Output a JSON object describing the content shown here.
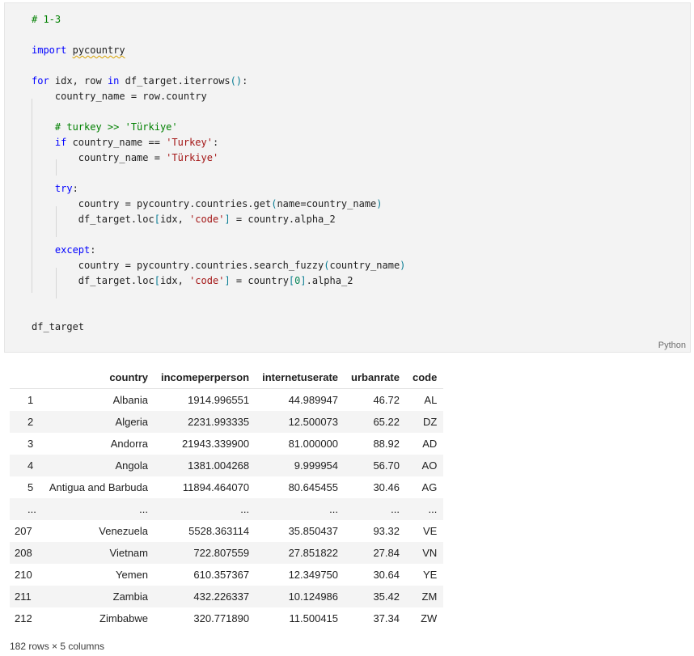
{
  "cell": {
    "language": "Python",
    "lines": [
      {
        "indent": 0,
        "tokens": [
          {
            "c": "cm",
            "t": "# 1-3"
          }
        ]
      },
      {
        "indent": 0,
        "tokens": []
      },
      {
        "indent": 0,
        "tokens": [
          {
            "c": "kw",
            "t": "import"
          },
          {
            "c": "",
            "t": " "
          },
          {
            "c": "squiggle",
            "t": "pycountry"
          }
        ]
      },
      {
        "indent": 0,
        "tokens": []
      },
      {
        "indent": 0,
        "tokens": [
          {
            "c": "kw",
            "t": "for"
          },
          {
            "c": "",
            "t": " idx, row "
          },
          {
            "c": "kw",
            "t": "in"
          },
          {
            "c": "",
            "t": " df_target.iterrows"
          },
          {
            "c": "paren",
            "t": "()"
          },
          {
            "c": "",
            "t": ":"
          }
        ]
      },
      {
        "indent": 1,
        "tokens": [
          {
            "c": "",
            "t": "country_name = row.country"
          }
        ]
      },
      {
        "indent": 1,
        "tokens": []
      },
      {
        "indent": 1,
        "tokens": [
          {
            "c": "cm",
            "t": "# turkey >> 'Türkiye'"
          }
        ]
      },
      {
        "indent": 1,
        "tokens": [
          {
            "c": "kw",
            "t": "if"
          },
          {
            "c": "",
            "t": " country_name == "
          },
          {
            "c": "str",
            "t": "'Turkey'"
          },
          {
            "c": "",
            "t": ":"
          }
        ]
      },
      {
        "indent": 2,
        "tokens": [
          {
            "c": "",
            "t": "country_name = "
          },
          {
            "c": "str",
            "t": "'Türkiye'"
          }
        ]
      },
      {
        "indent": 1,
        "tokens": []
      },
      {
        "indent": 1,
        "tokens": [
          {
            "c": "kw",
            "t": "try"
          },
          {
            "c": "",
            "t": ":"
          }
        ]
      },
      {
        "indent": 2,
        "tokens": [
          {
            "c": "",
            "t": "country = pycountry.countries.get"
          },
          {
            "c": "paren",
            "t": "("
          },
          {
            "c": "",
            "t": "name=country_name"
          },
          {
            "c": "paren",
            "t": ")"
          }
        ]
      },
      {
        "indent": 2,
        "tokens": [
          {
            "c": "",
            "t": "df_target.loc"
          },
          {
            "c": "paren",
            "t": "["
          },
          {
            "c": "",
            "t": "idx, "
          },
          {
            "c": "str",
            "t": "'code'"
          },
          {
            "c": "paren",
            "t": "]"
          },
          {
            "c": "",
            "t": " = country.alpha_2"
          }
        ]
      },
      {
        "indent": 1,
        "tokens": []
      },
      {
        "indent": 1,
        "tokens": [
          {
            "c": "kw",
            "t": "except"
          },
          {
            "c": "",
            "t": ":"
          }
        ]
      },
      {
        "indent": 2,
        "tokens": [
          {
            "c": "",
            "t": "country = pycountry.countries.search_fuzzy"
          },
          {
            "c": "paren",
            "t": "("
          },
          {
            "c": "",
            "t": "country_name"
          },
          {
            "c": "paren",
            "t": ")"
          }
        ]
      },
      {
        "indent": 2,
        "tokens": [
          {
            "c": "",
            "t": "df_target.loc"
          },
          {
            "c": "paren",
            "t": "["
          },
          {
            "c": "",
            "t": "idx, "
          },
          {
            "c": "str",
            "t": "'code'"
          },
          {
            "c": "paren",
            "t": "]"
          },
          {
            "c": "",
            "t": " = country"
          },
          {
            "c": "paren",
            "t": "["
          },
          {
            "c": "num",
            "t": "0"
          },
          {
            "c": "paren",
            "t": "]"
          },
          {
            "c": "",
            "t": ".alpha_2"
          }
        ]
      },
      {
        "indent": 0,
        "tokens": []
      },
      {
        "indent": 0,
        "tokens": []
      },
      {
        "indent": 0,
        "tokens": [
          {
            "c": "",
            "t": "df_target"
          }
        ]
      }
    ]
  },
  "output": {
    "columns": [
      "",
      "country",
      "incomeperperson",
      "internetuserate",
      "urbanrate",
      "code"
    ],
    "rows": [
      [
        "1",
        "Albania",
        "1914.996551",
        "44.989947",
        "46.72",
        "AL"
      ],
      [
        "2",
        "Algeria",
        "2231.993335",
        "12.500073",
        "65.22",
        "DZ"
      ],
      [
        "3",
        "Andorra",
        "21943.339900",
        "81.000000",
        "88.92",
        "AD"
      ],
      [
        "4",
        "Angola",
        "1381.004268",
        "9.999954",
        "56.70",
        "AO"
      ],
      [
        "5",
        "Antigua and Barbuda",
        "11894.464070",
        "80.645455",
        "30.46",
        "AG"
      ],
      [
        "...",
        "...",
        "...",
        "...",
        "...",
        "..."
      ],
      [
        "207",
        "Venezuela",
        "5528.363114",
        "35.850437",
        "93.32",
        "VE"
      ],
      [
        "208",
        "Vietnam",
        "722.807559",
        "27.851822",
        "27.84",
        "VN"
      ],
      [
        "210",
        "Yemen",
        "610.357367",
        "12.349750",
        "30.64",
        "YE"
      ],
      [
        "211",
        "Zambia",
        "432.226337",
        "10.124986",
        "35.42",
        "ZM"
      ],
      [
        "212",
        "Zimbabwe",
        "320.771890",
        "11.500415",
        "37.34",
        "ZW"
      ]
    ],
    "summary": "182 rows × 5 columns"
  }
}
